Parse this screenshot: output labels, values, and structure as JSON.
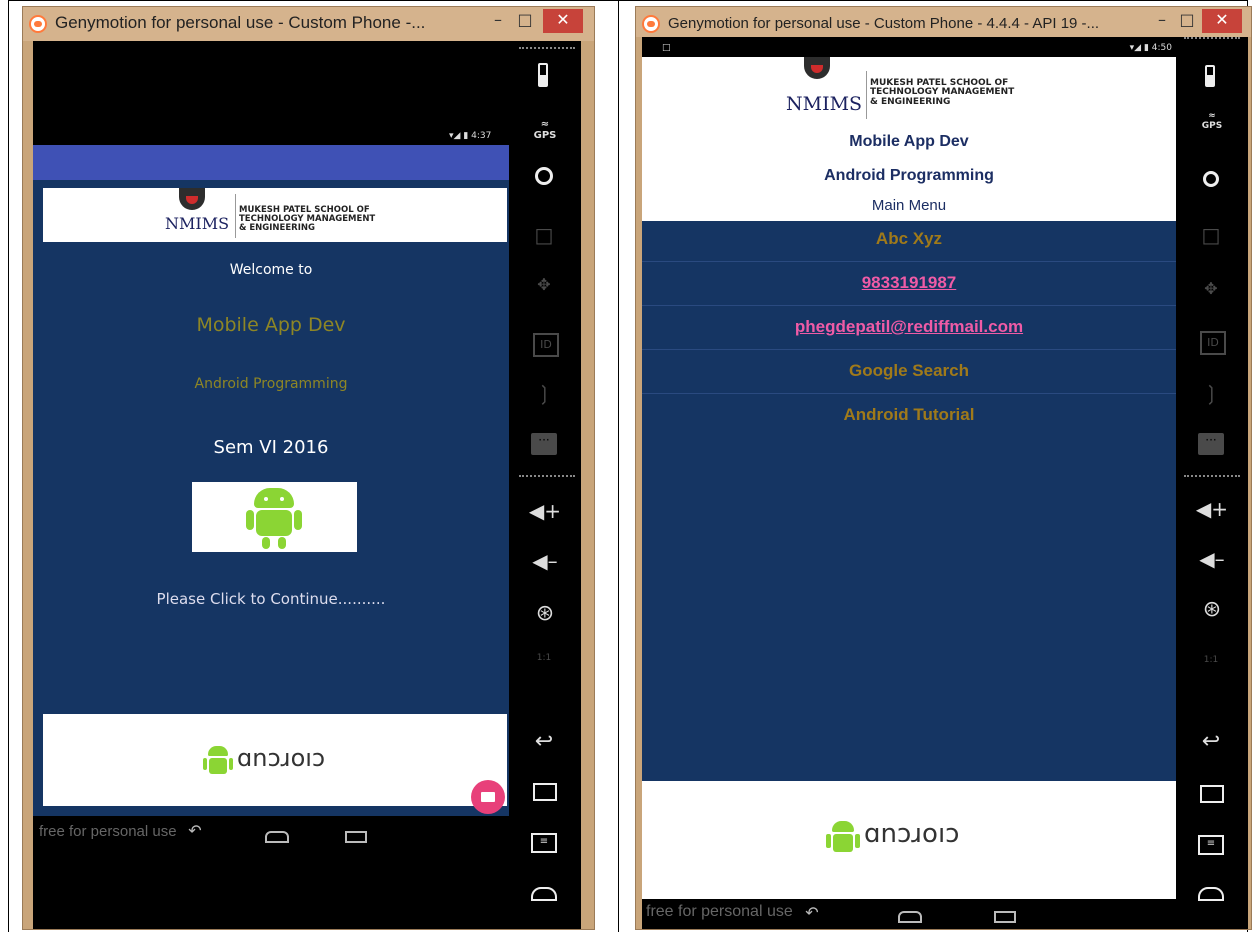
{
  "left": {
    "window_title": "Genymotion for personal use - Custom Phone -...",
    "status_time": "4:37",
    "banner": {
      "logo": "NMIMS",
      "line1": "MUKESH PATEL SCHOOL OF",
      "line2": "TECHNOLOGY MANAGEMENT",
      "line3": "& ENGINEERING"
    },
    "welcome": "Welcome to",
    "app_title": "Mobile App Dev",
    "subtitle": "Android Programming",
    "sem": "Sem VI 2016",
    "click_text": "Please Click to Continue..........",
    "android_wordmark": "ɑnɔɹoıɔ",
    "watermark": "free for personal use"
  },
  "right": {
    "window_title": "Genymotion for personal use - Custom Phone - 4.4.4 - API 19 -...",
    "status_time": "4:50",
    "banner": {
      "logo": "NMIMS",
      "line1": "MUKESH PATEL SCHOOL OF",
      "line2": "TECHNOLOGY MANAGEMENT",
      "line3": "& ENGINEERING"
    },
    "app_title": "Mobile App Dev",
    "subtitle": "Android Programming",
    "menu_title": "Main Menu",
    "menu_items": [
      "Abc Xyz",
      "9833191987",
      "phegdepatil@rediffmail.com",
      "Google Search",
      "Android Tutorial"
    ],
    "android_wordmark": "ɑnɔɹoıɔ",
    "watermark": "free for personal use"
  },
  "sidebar_icons": [
    "battery-icon",
    "gps-icon",
    "webcam-icon",
    "clapper-icon",
    "dpad-icon",
    "id-icon",
    "cast-icon",
    "sms-icon",
    "volume-up-icon",
    "volume-down-icon",
    "rotate-icon",
    "pixel-perfect-icon",
    "back-icon",
    "recent-apps-icon",
    "menu-icon",
    "home-icon"
  ],
  "sidebar_labels": {
    "gps": "GPS",
    "id": "ID",
    "scale": "1:1"
  },
  "colors": {
    "screen_bg": "#153563",
    "accent_gold": "#8e8625",
    "link_pink": "#f05ba6",
    "appbar_blue": "#3f51b5",
    "fab_pink": "#e8407a",
    "android_green": "#8bd534"
  }
}
